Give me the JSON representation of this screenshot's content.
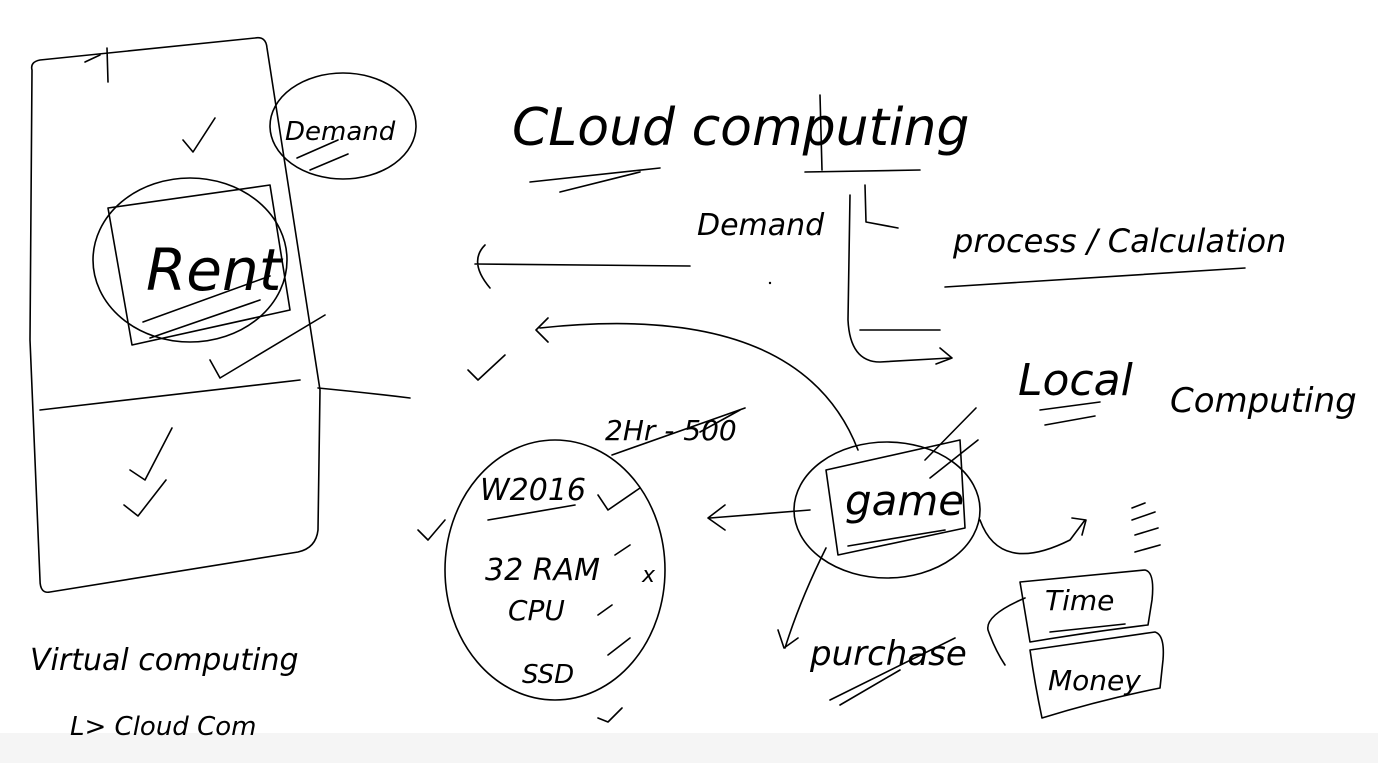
{
  "whiteboard": {
    "title": "CLoud computing",
    "demand": "Demand",
    "process": "process / Calculation",
    "local": "Local",
    "local_computing": "Computing",
    "rent": "Rent",
    "demand_note": "Demand",
    "virtual": "Virtual computing",
    "cloud_com": "L> Cloud Com",
    "hr": "2Hr - 500",
    "w2016": "W2016",
    "ram": "32 RAM",
    "cpu": "CPU",
    "ssd": "SSD",
    "x_mark": "x",
    "game": "game",
    "purchase": "purchase",
    "time": "Time",
    "money": "Money"
  }
}
